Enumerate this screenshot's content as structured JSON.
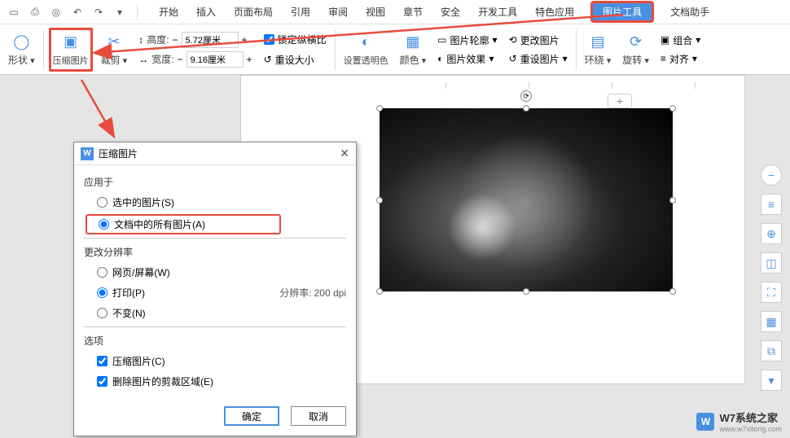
{
  "menu": {
    "start": "开始",
    "insert": "插入",
    "page_layout": "页面布局",
    "references": "引用",
    "review": "审阅",
    "view": "视图",
    "chapter": "章节",
    "security": "安全",
    "dev_tools": "开发工具",
    "special": "特色应用",
    "picture_tools": "图片工具",
    "doc_helper": "文档助手"
  },
  "ribbon": {
    "shape": "形状",
    "compress": "压缩图片",
    "crop": "裁剪",
    "height_label": "高度:",
    "height_value": "5.72厘米",
    "width_label": "宽度:",
    "width_value": "9.16厘米",
    "lock_ratio": "锁定纵横比",
    "reset_size": "重设大小",
    "set_transparent": "设置透明色",
    "color": "颜色",
    "picture_outline": "图片轮廓",
    "picture_effects": "图片效果",
    "change_picture": "更改图片",
    "reset_picture": "重设图片",
    "wrap": "环绕",
    "rotate": "旋转",
    "group": "组合",
    "align": "对齐"
  },
  "dialog": {
    "title": "压缩图片",
    "apply_to": "应用于",
    "selected_pictures": "选中的图片(S)",
    "all_pictures": "文档中的所有图片(A)",
    "change_resolution": "更改分辨率",
    "web_screen": "网页/屏幕(W)",
    "print": "打印(P)",
    "no_change": "不变(N)",
    "resolution_label": "分辨率:",
    "resolution_value": "200 dpi",
    "options_label": "选项",
    "compress_opt": "压缩图片(C)",
    "delete_cropped": "删除图片的剪裁区域(E)",
    "ok": "确定",
    "cancel": "取消"
  },
  "page": {
    "add": "+"
  },
  "watermark": {
    "logo": "W",
    "brand": "W7系统之家",
    "url": "www.w7xitong.com"
  }
}
